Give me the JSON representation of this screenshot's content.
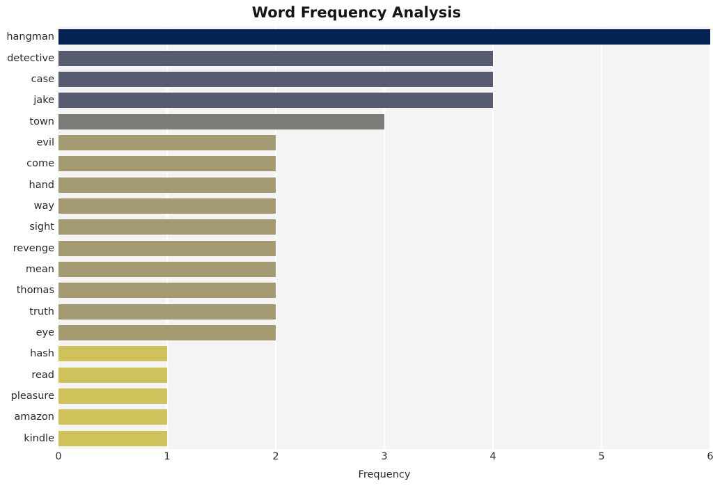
{
  "chart_data": {
    "type": "bar",
    "orientation": "horizontal",
    "title": "Word Frequency Analysis",
    "xlabel": "Frequency",
    "ylabel": "",
    "categories": [
      "hangman",
      "detective",
      "case",
      "jake",
      "town",
      "evil",
      "come",
      "hand",
      "way",
      "sight",
      "revenge",
      "mean",
      "thomas",
      "truth",
      "eye",
      "hash",
      "read",
      "pleasure",
      "amazon",
      "kindle"
    ],
    "values": [
      6,
      4,
      4,
      4,
      3,
      2,
      2,
      2,
      2,
      2,
      2,
      2,
      2,
      2,
      2,
      1,
      1,
      1,
      1,
      1
    ],
    "bar_colors": [
      "#042253",
      "#575c70",
      "#575c70",
      "#575c70",
      "#7d7b78",
      "#a49a72",
      "#a49a72",
      "#a49a72",
      "#a49a72",
      "#a49a72",
      "#a49a72",
      "#a49a72",
      "#a49a72",
      "#a49a72",
      "#a49a72",
      "#d0c25b",
      "#d0c25b",
      "#d0c25b",
      "#d0c25b",
      "#d0c25b"
    ],
    "xlim": [
      0,
      6
    ],
    "xticks": [
      0,
      1,
      2,
      3,
      4,
      5,
      6
    ],
    "xtick_labels": [
      "0",
      "1",
      "2",
      "3",
      "4",
      "5",
      "6"
    ],
    "grid": true,
    "grid_axis": "x",
    "grid_color": "#ffffff",
    "plot_background": "#f4f4f5",
    "figure_background": "#ffffff",
    "legend": null,
    "legend_position": "none"
  }
}
